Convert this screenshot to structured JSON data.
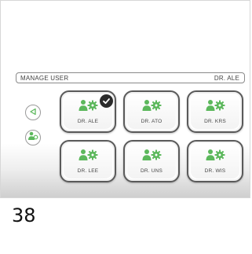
{
  "header": {
    "title": "MANAGE USER",
    "current_user": "DR. ALE"
  },
  "sidebar": {
    "back_icon": "triangle-left-icon",
    "add_user_icon": "add-user-icon"
  },
  "tiles": [
    {
      "label": "DR. ALE",
      "selected": true
    },
    {
      "label": "DR. ATO",
      "selected": false
    },
    {
      "label": "DR. KRS",
      "selected": false
    },
    {
      "label": "DR. LEE",
      "selected": false
    },
    {
      "label": "DR. UNS",
      "selected": false
    },
    {
      "label": "DR. WIS",
      "selected": false
    }
  ],
  "colors": {
    "accent_green": "#5cb85c",
    "border_gray": "#5a5a5a"
  },
  "page_number": "38"
}
